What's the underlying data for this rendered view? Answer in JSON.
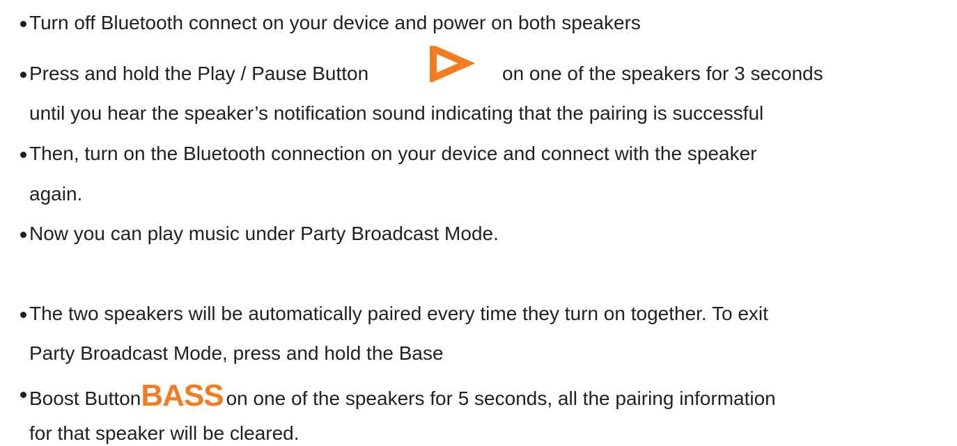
{
  "steps": [
    {
      "lines": [
        "Turn off Bluetooth connect on your device and power on both speakers"
      ]
    },
    {
      "before_icon": "Press and hold the Play / Pause Button",
      "icon": "play-triangle-icon",
      "after_icon": "on one of the speakers for 3 seconds",
      "line2": "until you hear the speaker’s notification sound indicating that the pairing is successful"
    },
    {
      "lines": [
        "Then, turn on the Bluetooth connection on your device and connect with the speaker",
        "again."
      ]
    },
    {
      "lines": [
        "Now you can play music under Party Broadcast Mode."
      ]
    },
    {
      "lines": [
        "The two speakers will be automatically paired every time they turn on together. To exit",
        "Party Broadcast Mode, press and hold the Base"
      ]
    },
    {
      "before_logo": "Boost Button",
      "logo_text": "BASS",
      "after_logo": "on one of the speakers for 5 seconds, all the pairing information",
      "line2": "for that speaker will be cleared."
    }
  ],
  "colors": {
    "text": "#231f20",
    "accent_orange": "#f47b20"
  }
}
